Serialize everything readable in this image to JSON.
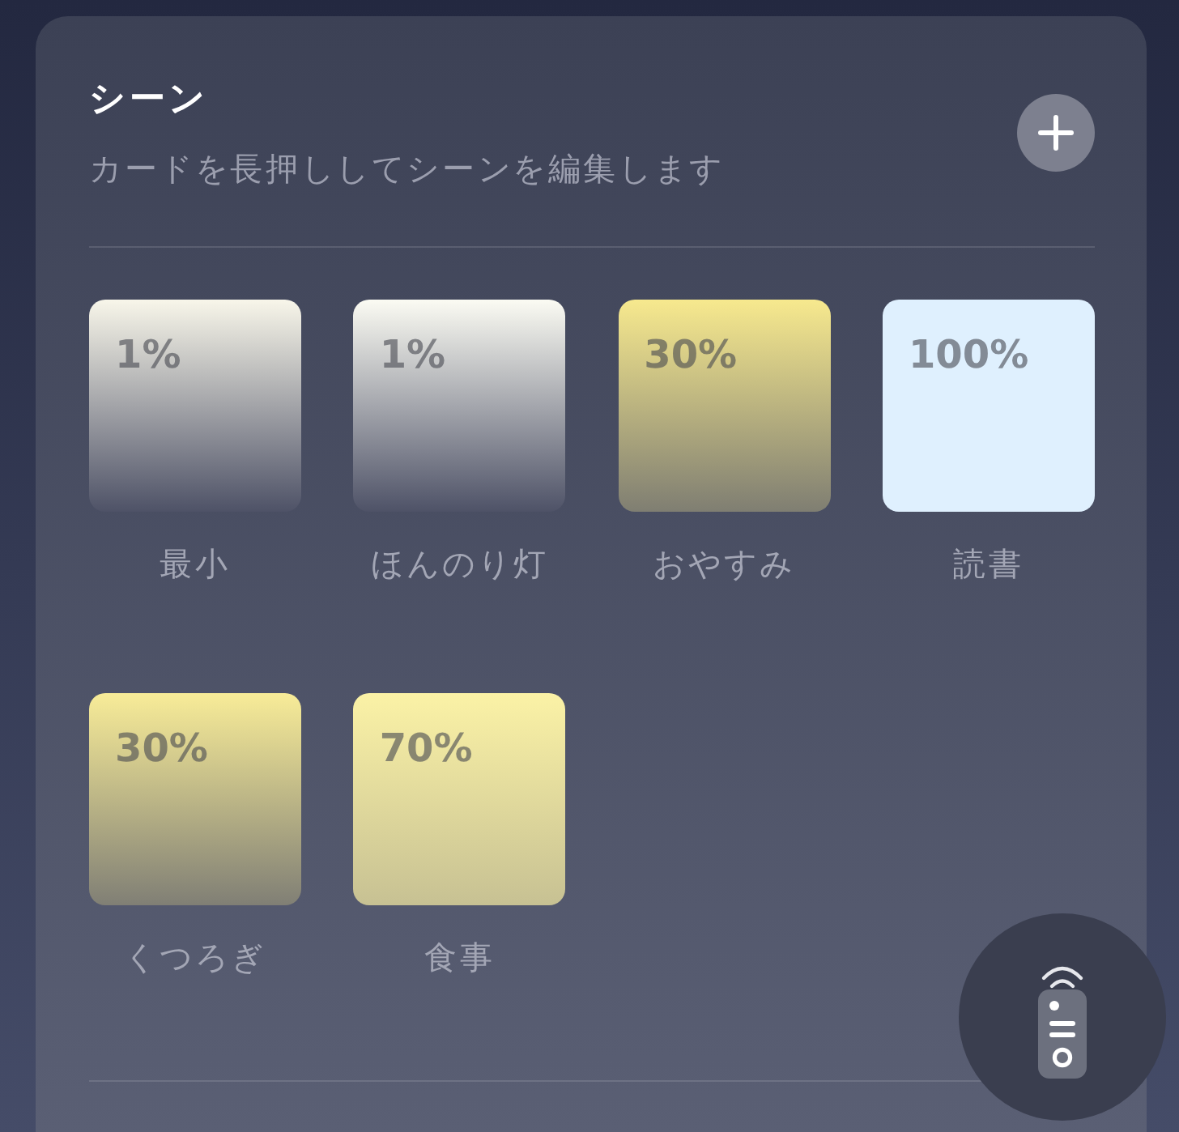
{
  "header": {
    "title": "シーン",
    "subtitle": "カードを長押ししてシーンを編集します"
  },
  "scenes": [
    {
      "name": "最小",
      "brightness": "1%",
      "color": "#f8f6ea"
    },
    {
      "name": "ほんのり灯",
      "brightness": "1%",
      "color": "#fbfbf3"
    },
    {
      "name": "おやすみ",
      "brightness": "30%",
      "color": "#f7e98e"
    },
    {
      "name": "読書",
      "brightness": "100%",
      "color": "#dff0fe"
    },
    {
      "name": "くつろぎ",
      "brightness": "30%",
      "color": "#f8ec98"
    },
    {
      "name": "食事",
      "brightness": "70%",
      "color": "#fbf2a6"
    }
  ]
}
